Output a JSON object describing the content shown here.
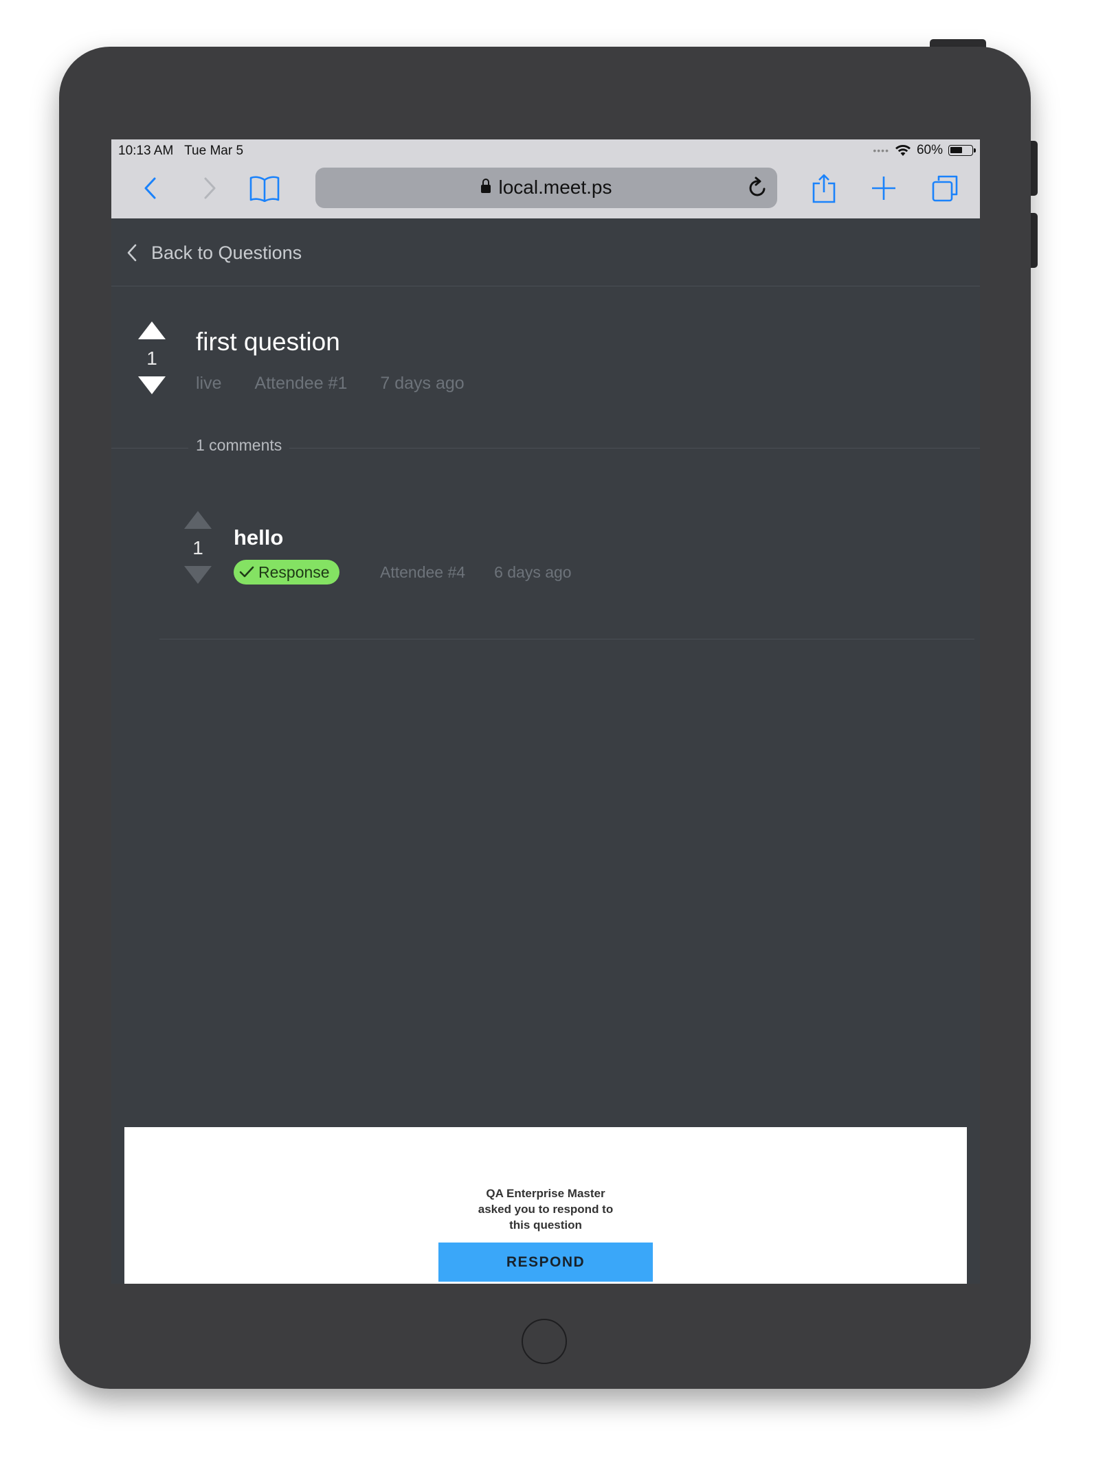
{
  "status_bar": {
    "time": "10:13 AM",
    "date": "Tue Mar 5",
    "wifi_icon": "wifi-icon",
    "battery_percent": "60%",
    "battery_level": 0.6
  },
  "browser": {
    "url": "local.meet.ps",
    "icons": [
      "back-icon",
      "forward-icon",
      "bookmarks-icon",
      "lock-icon",
      "reload-icon",
      "share-icon",
      "new-tab-icon",
      "tabs-icon"
    ]
  },
  "page": {
    "back_label": "Back to Questions",
    "question": {
      "votes": "1",
      "title": "first question",
      "status": "live",
      "author": "Attendee #1",
      "time": "7 days ago"
    },
    "comments_label": "1 comments",
    "comments": [
      {
        "votes": "1",
        "text": "hello",
        "badge": "Response",
        "author": "Attendee #4",
        "time": "6 days ago"
      }
    ]
  },
  "prompt": {
    "lines": [
      "QA Enterprise Master",
      "asked you to respond to",
      "this question"
    ],
    "button": "RESPOND"
  },
  "colors": {
    "page_bg": "#3a3e43",
    "accent_blue": "#3aa7f9",
    "badge_green": "#84e263",
    "safari_blue": "#1a82fb"
  }
}
